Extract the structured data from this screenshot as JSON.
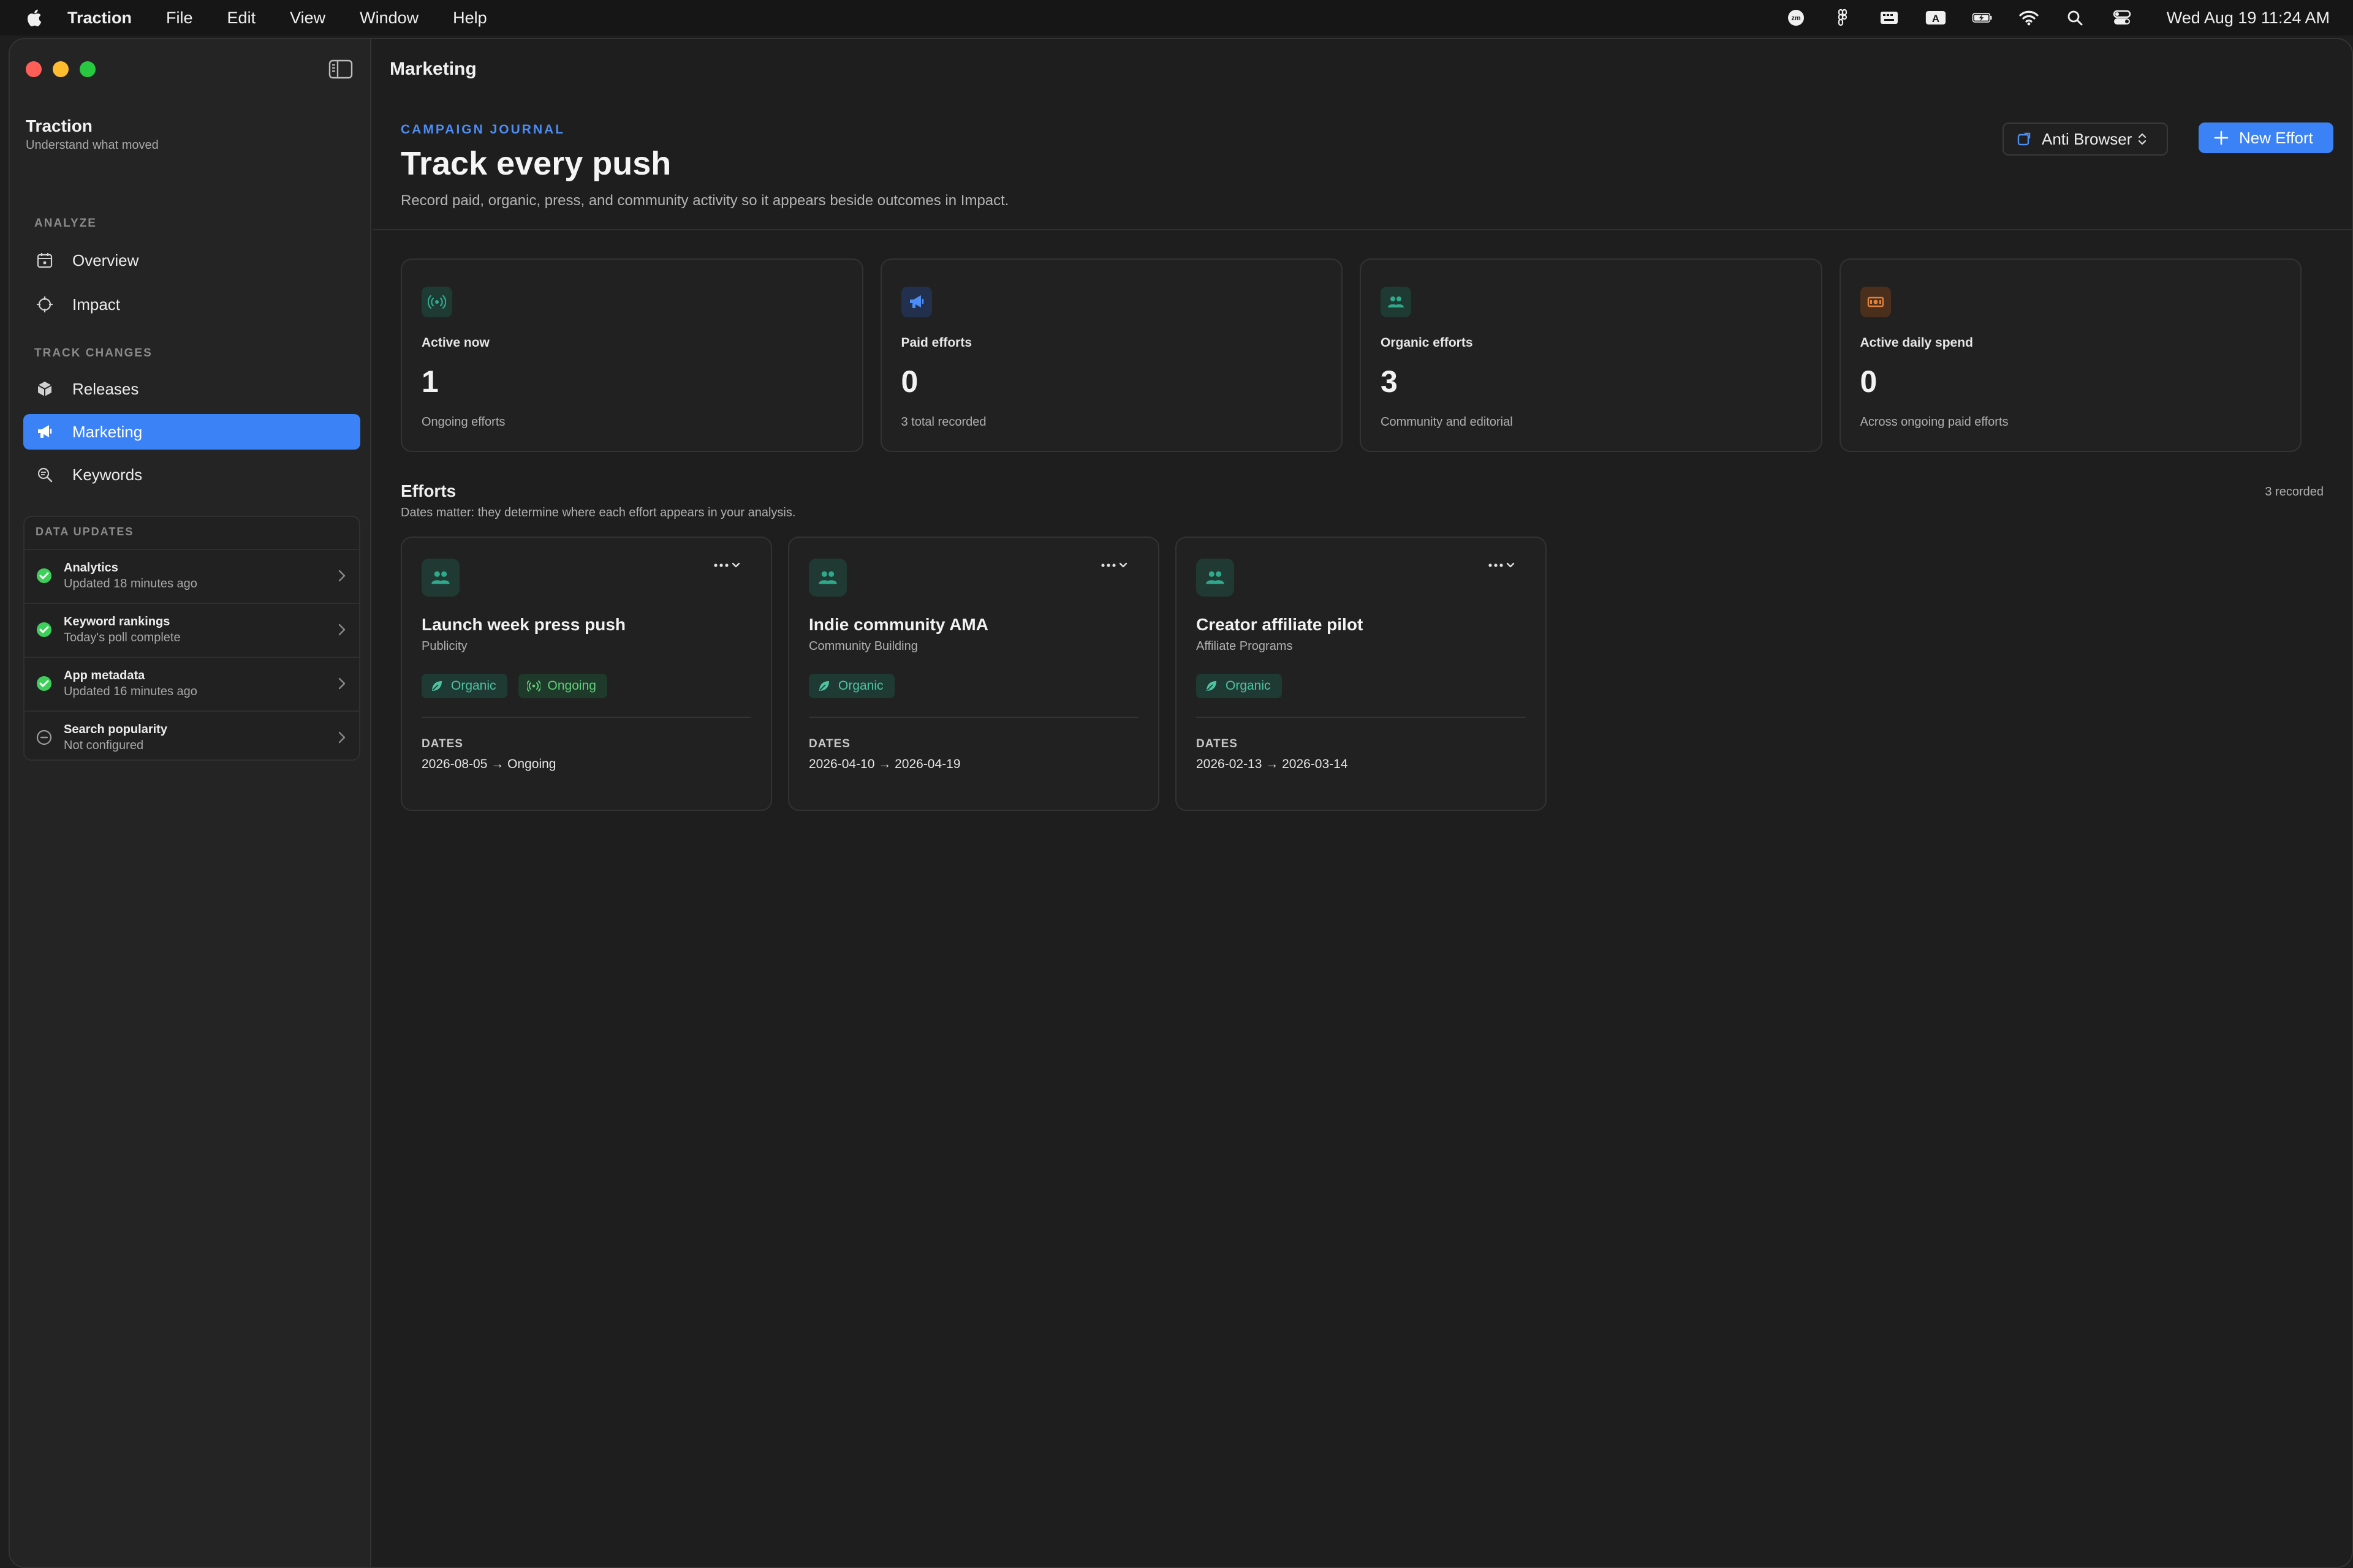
{
  "menubar": {
    "app_name": "Traction",
    "menus": [
      "File",
      "Edit",
      "View",
      "Window",
      "Help"
    ],
    "status_icons": [
      "zoom-icon",
      "figma-icon",
      "display-icon",
      "keyboard-input-icon",
      "battery-charging-icon",
      "wifi-icon",
      "search-icon",
      "control-center-icon"
    ],
    "input_source": "A",
    "zoom_label": "zm",
    "clock": "Wed Aug 19  11:24 AM"
  },
  "sidebar": {
    "app_name": "Traction",
    "tagline": "Understand what moved",
    "analyze_label": "ANALYZE",
    "track_label": "TRACK CHANGES",
    "nav": {
      "overview": "Overview",
      "impact": "Impact",
      "releases": "Releases",
      "marketing": "Marketing",
      "keywords": "Keywords"
    },
    "data_updates": {
      "label": "DATA UPDATES",
      "items": [
        {
          "title": "Analytics",
          "status": "Updated 18 minutes ago",
          "state": "ok"
        },
        {
          "title": "Keyword rankings",
          "status": "Today's poll complete",
          "state": "ok"
        },
        {
          "title": "App metadata",
          "status": "Updated 16 minutes ago",
          "state": "ok"
        },
        {
          "title": "Search popularity",
          "status": "Not configured",
          "state": "off"
        }
      ]
    }
  },
  "toolbar": {
    "title": "Marketing"
  },
  "header": {
    "eyebrow": "CAMPAIGN JOURNAL",
    "title": "Track every push",
    "subtitle": "Record paid, organic, press, and community activity so it appears beside outcomes in Impact.",
    "app_selector": "Anti Browser",
    "new_button": "New Effort"
  },
  "stats": [
    {
      "label": "Active now",
      "value": "1",
      "sub": "Ongoing efforts",
      "icon": "broadcast-icon",
      "color": "#2fa98c"
    },
    {
      "label": "Paid efforts",
      "value": "0",
      "sub": "3 total recorded",
      "icon": "megaphone-icon",
      "color": "#4d8df6"
    },
    {
      "label": "Organic efforts",
      "value": "3",
      "sub": "Community and editorial",
      "icon": "people-icon",
      "color": "#2fa98c"
    },
    {
      "label": "Active daily spend",
      "value": "0",
      "sub": "Across ongoing paid efforts",
      "icon": "banknote-icon",
      "color": "#e0823a"
    }
  ],
  "efforts": {
    "title": "Efforts",
    "subtitle": "Dates matter: they determine where each effort appears in your analysis.",
    "count": "3 recorded",
    "dates_label": "DATES",
    "items": [
      {
        "name": "Launch week press push",
        "category": "Publicity",
        "tags": [
          "Organic",
          "Ongoing"
        ],
        "dates": "2026-08-05 → Ongoing"
      },
      {
        "name": "Indie community AMA",
        "category": "Community Building",
        "tags": [
          "Organic"
        ],
        "dates": "2026-04-10 → 2026-04-19"
      },
      {
        "name": "Creator affiliate pilot",
        "category": "Affiliate Programs",
        "tags": [
          "Organic"
        ],
        "dates": "2026-02-13 → 2026-03-14"
      }
    ]
  },
  "colors": {
    "accent": "#3b82f6",
    "organic": "#4fc3a1",
    "ongoing": "#5fd07a",
    "success": "#3ecf5a"
  }
}
